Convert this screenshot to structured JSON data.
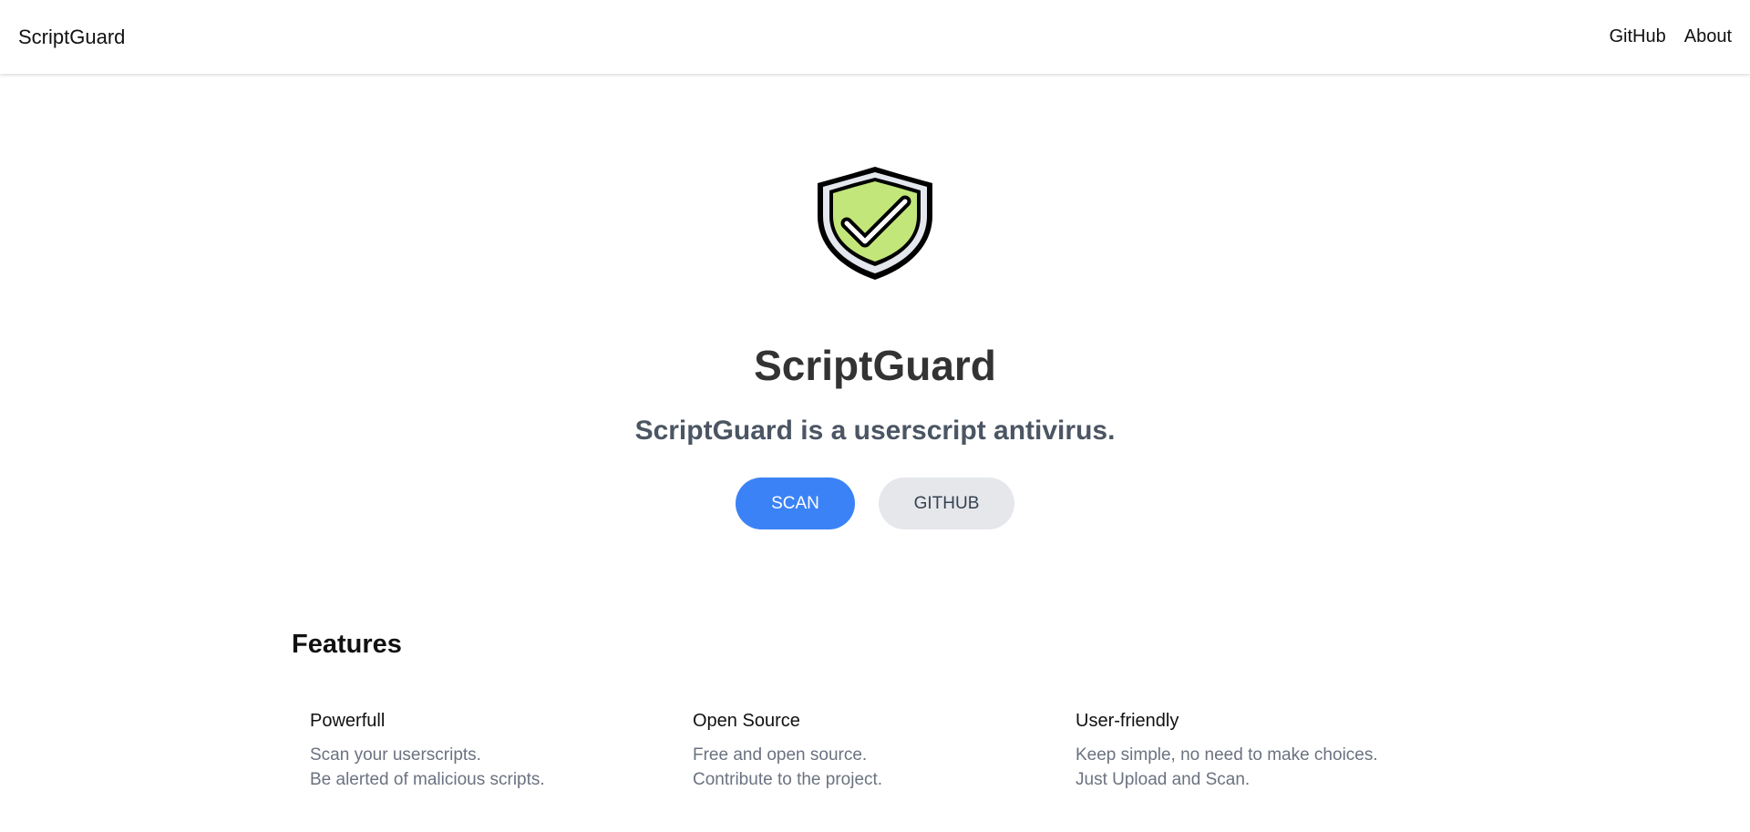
{
  "navbar": {
    "brand": "ScriptGuard",
    "links": [
      {
        "label": "GitHub"
      },
      {
        "label": "About"
      }
    ]
  },
  "hero": {
    "logo_icon": "shield-check-icon",
    "title": "ScriptGuard",
    "subtitle": "ScriptGuard is a userscript antivirus.",
    "scan_button": "SCAN",
    "github_button": "GITHUB"
  },
  "features": {
    "heading": "Features",
    "items": [
      {
        "title": "Powerfull",
        "lines": [
          "Scan your userscripts.",
          "Be alerted of malicious scripts."
        ]
      },
      {
        "title": "Open Source",
        "lines": [
          "Free and open source.",
          "Contribute to the project."
        ]
      },
      {
        "title": "User-friendly",
        "lines": [
          "Keep simple, no need to make choices.",
          "Just Upload and Scan."
        ]
      }
    ]
  },
  "colors": {
    "primary": "#3b82f6",
    "secondary": "#e5e7eb",
    "shield_fill": "#c3e67a"
  }
}
